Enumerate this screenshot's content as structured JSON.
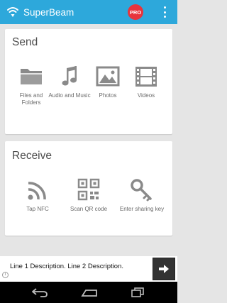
{
  "app": {
    "title": "SuperBeam",
    "pro_badge": "PRO"
  },
  "colors": {
    "appbar": "#2da8db",
    "pro_badge": "#e8343c",
    "icon_gray": "#8a8a8a",
    "text_gray": "#6a6a6a"
  },
  "send": {
    "title": "Send",
    "actions": [
      {
        "label": "Files and Folders",
        "icon": "folder-icon"
      },
      {
        "label": "Audio and Music",
        "icon": "music-note-icon"
      },
      {
        "label": "Photos",
        "icon": "image-icon"
      },
      {
        "label": "Videos",
        "icon": "film-icon"
      }
    ]
  },
  "receive": {
    "title": "Receive",
    "actions": [
      {
        "label": "Tap NFC",
        "icon": "nfc-icon"
      },
      {
        "label": "Scan QR code",
        "icon": "qr-code-icon"
      },
      {
        "label": "Enter sharing key",
        "icon": "key-icon"
      }
    ]
  },
  "ad": {
    "text": "Line 1 Description. Line 2 Description.",
    "info_glyph": "i"
  }
}
